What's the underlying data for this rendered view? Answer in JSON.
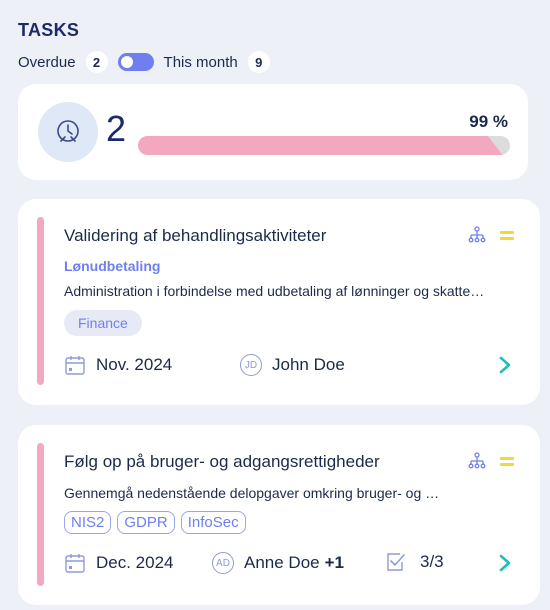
{
  "header": {
    "title": "TASKS",
    "overdue_label": "Overdue",
    "overdue_count": "2",
    "this_month_label": "This month",
    "this_month_count": "9"
  },
  "summary": {
    "count": "2",
    "percent_label": "99 %",
    "progress": 0.99
  },
  "tasks": [
    {
      "title": "Validering af behandlingsaktiviteter",
      "category": "Lønudbetaling",
      "description": "Administration i forbindelse med udbetaling af lønninger og skatte…",
      "tags": [
        "Finance"
      ],
      "date": "Nov. 2024",
      "assignee_initials": "JD",
      "assignee": "John Doe"
    },
    {
      "title": "Følg op på bruger- og adgangsrettigheder",
      "description": "Gennemgå nedenstående delopgaver omkring bruger- og …",
      "tags": [
        "NIS2",
        "GDPR",
        "InfoSec"
      ],
      "date": "Dec. 2024",
      "assignee_initials": "AD",
      "assignee": "Anne Doe",
      "assignee_extra": "+1",
      "subtasks": "3/3"
    }
  ],
  "colors": {
    "accent": "#6f7ff0",
    "pink": "#f4a8bf",
    "teal": "#1fc0b5",
    "priority": "#f0d83a"
  }
}
